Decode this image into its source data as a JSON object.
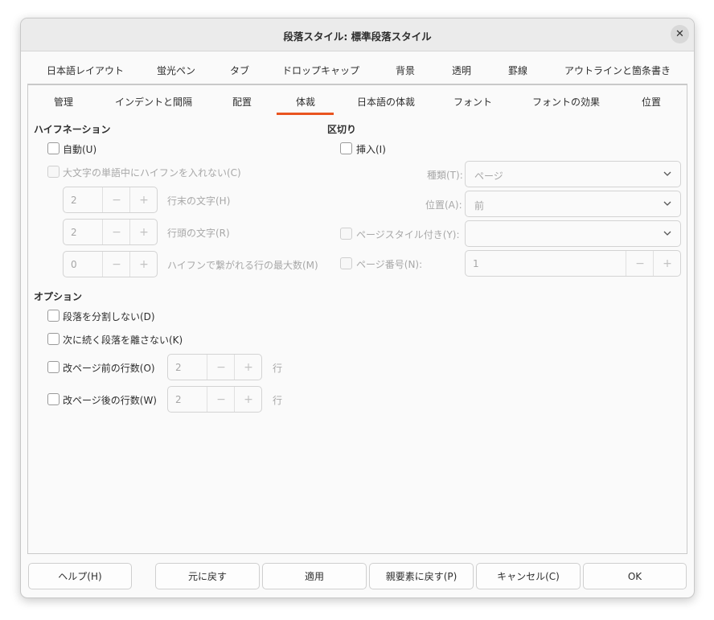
{
  "window": {
    "title": "段落スタイル: 標準段落スタイル"
  },
  "tabs_row1": [
    "日本語レイアウト",
    "蛍光ペン",
    "タブ",
    "ドロップキャップ",
    "背景",
    "透明",
    "罫線",
    "アウトラインと箇条書き"
  ],
  "tabs_row2": [
    "管理",
    "インデントと間隔",
    "配置",
    "体裁",
    "日本語の体裁",
    "フォント",
    "フォントの効果",
    "位置"
  ],
  "active_tab": "体裁",
  "hyphenation": {
    "heading": "ハイフネーション",
    "auto_label": "自動(U)",
    "no_caps_label": "大文字の単語中にハイフンを入れない(C)",
    "end_chars": {
      "value": "2",
      "label": "行末の文字(H)"
    },
    "start_chars": {
      "value": "2",
      "label": "行頭の文字(R)"
    },
    "max_lines": {
      "value": "0",
      "label": "ハイフンで繋がれる行の最大数(M)"
    },
    "spin_minus": "−",
    "spin_plus": "+"
  },
  "breaks": {
    "heading": "区切り",
    "insert_label": "挿入(I)",
    "type_label": "種類(T):",
    "type_value": "ページ",
    "position_label": "位置(A):",
    "position_value": "前",
    "page_style_label": "ページスタイル付き(Y):",
    "page_style_value": "",
    "page_number_label": "ページ番号(N):",
    "page_number_value": "1"
  },
  "options": {
    "heading": "オプション",
    "no_split_label": "段落を分割しない(D)",
    "keep_next_label": "次に続く段落を離さない(K)",
    "orphan_label": "改ページ前の行数(O)",
    "orphan_value": "2",
    "widow_label": "改ページ後の行数(W)",
    "widow_value": "2",
    "lines_unit": "行"
  },
  "buttons": {
    "help": "ヘルプ(H)",
    "reset": "元に戻す",
    "apply": "適用",
    "reset_parent": "親要素に戻す(P)",
    "cancel": "キャンセル(C)",
    "ok": "OK"
  },
  "colors": {
    "accent": "#e95420"
  }
}
